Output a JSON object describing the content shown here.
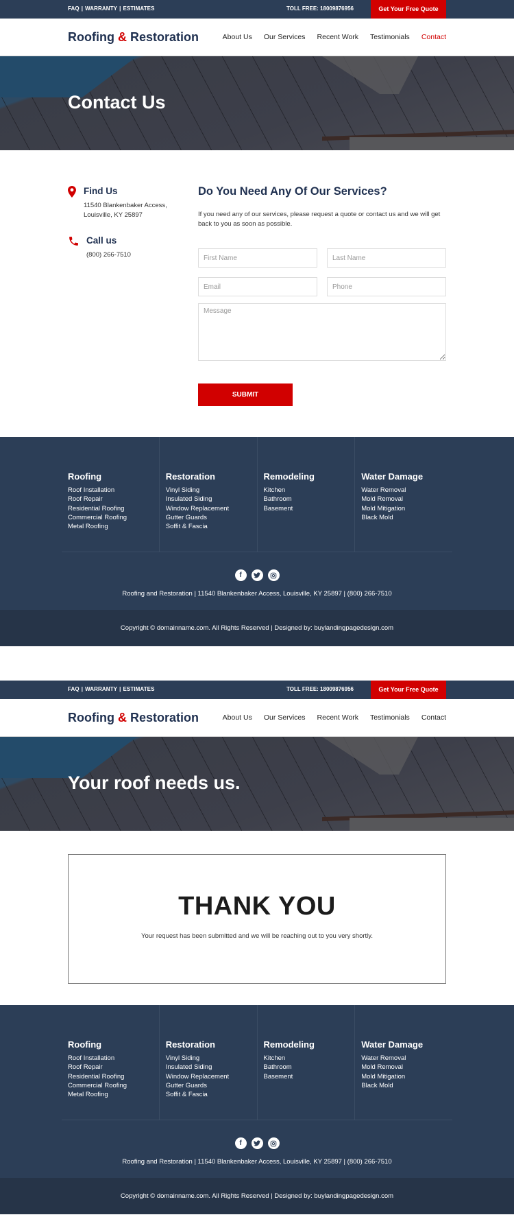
{
  "brand": {
    "accent": "#d10000",
    "navy": "#2c3e57",
    "name_part1": "Roofing",
    "amp": "&",
    "name_part2": "Restoration"
  },
  "topbar": {
    "links": [
      "FAQ",
      "WARRANTY",
      "ESTIMATES"
    ],
    "toll_free": "TOLL FREE: 18009876956",
    "quote_button": "Get Your Free Quote"
  },
  "nav": {
    "items": [
      "About Us",
      "Our Services",
      "Recent Work",
      "Testimonials",
      "Contact"
    ]
  },
  "contact_page": {
    "hero_title": "Contact Us",
    "find_us": {
      "title": "Find Us",
      "line1": "11540 Blankenbaker Access,",
      "line2": "Louisville, KY 25897",
      "icon": "map-pin-icon"
    },
    "call_us": {
      "title": "Call us",
      "phone": "(800) 266-7510",
      "icon": "phone-icon"
    },
    "form": {
      "title": "Do You Need Any Of Our Services?",
      "lead": "If you need any of our services, please request a quote or contact us and we will get back to you as soon as possible.",
      "first_name_placeholder": "First Name",
      "last_name_placeholder": "Last Name",
      "email_placeholder": "Email",
      "phone_placeholder": "Phone",
      "message_placeholder": "Message",
      "submit_label": "SUBMIT"
    }
  },
  "thankyou_page": {
    "hero_title": "Your roof needs us.",
    "heading": "THANK YOU",
    "message": "Your request has been submitted and we will be reaching out to you very shortly."
  },
  "footer": {
    "columns": [
      {
        "title": "Roofing",
        "items": [
          "Roof Installation",
          "Roof Repair",
          "Residential Roofing",
          "Commercial Roofing",
          "Metal Roofing"
        ]
      },
      {
        "title": "Restoration",
        "items": [
          "Vinyl Siding",
          "Insulated Siding",
          "Window Replacement",
          "Gutter Guards",
          "Soffit & Fascia"
        ]
      },
      {
        "title": "Remodeling",
        "items": [
          "Kitchen",
          "Bathroom",
          "Basement"
        ]
      },
      {
        "title": "Water Damage",
        "items": [
          "Water Removal",
          "Mold Removal",
          "Mold Mitigation",
          "Black Mold"
        ]
      }
    ],
    "social": [
      {
        "name": "facebook-icon",
        "glyph": "f"
      },
      {
        "name": "twitter-icon",
        "glyph": "t"
      },
      {
        "name": "instagram-icon",
        "glyph": "◎"
      }
    ],
    "address_line": "Roofing and Restoration | 11540 Blankenbaker Access, Louisville, KY 25897 | (800) 266-7510",
    "copyright": "Copyright © domainname.com. All Rights Reserved | Designed by: buylandingpagedesign.com"
  }
}
